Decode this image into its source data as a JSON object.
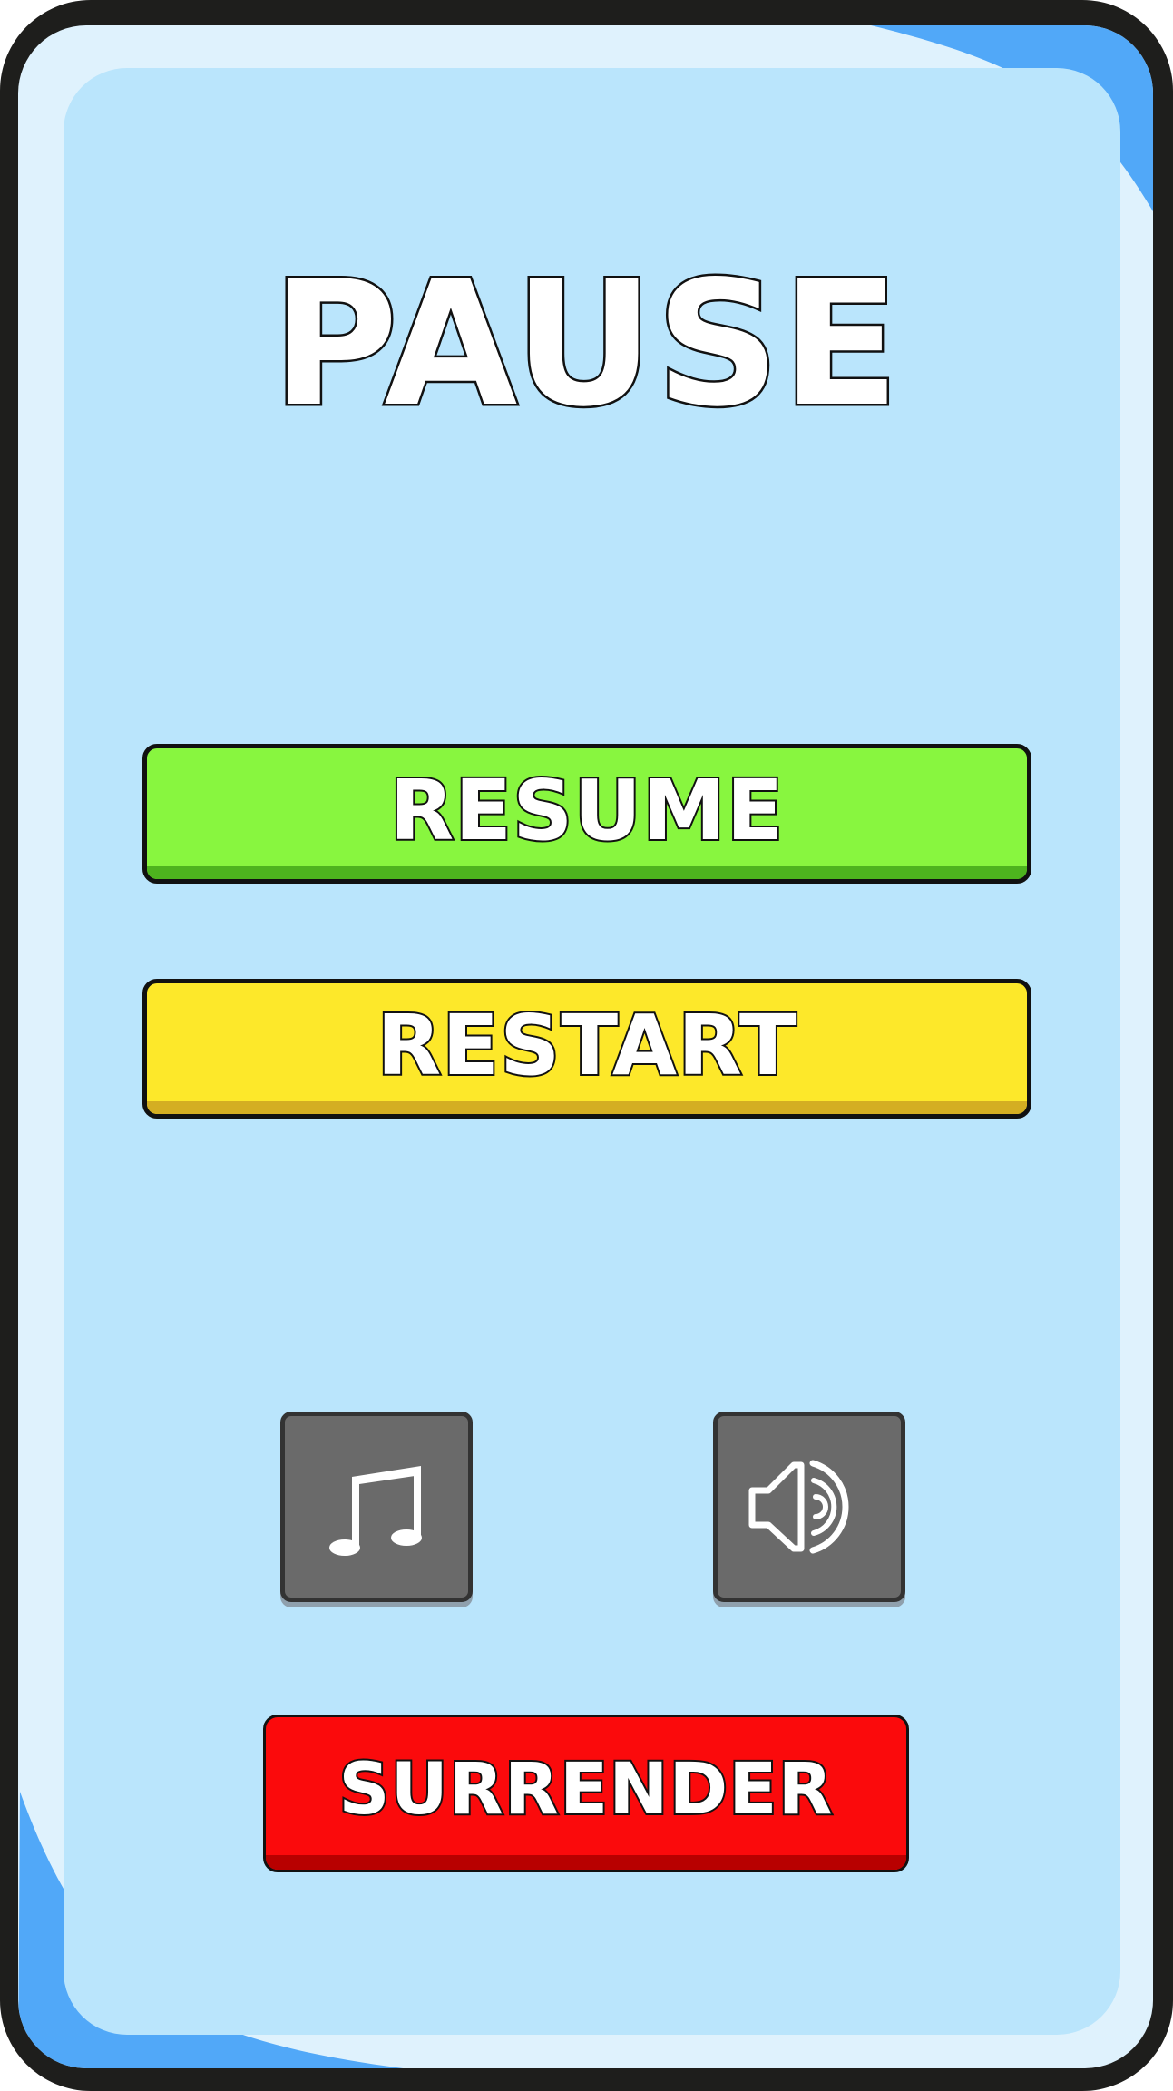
{
  "pause_menu": {
    "title": "PAUSE",
    "buttons": {
      "resume": "RESUME",
      "restart": "RESTART",
      "surrender": "SURRENDER"
    },
    "toggles": [
      {
        "name": "music",
        "icon": "music-note-icon"
      },
      {
        "name": "sound",
        "icon": "speaker-volume-icon"
      }
    ]
  },
  "colors": {
    "frame": "#1e1e1c",
    "panel_outer": "#dff2fd",
    "panel_inner": "#bae5fc",
    "corner_accent": "#51a8f8",
    "resume": "#88f63f",
    "restart": "#fde82a",
    "surrender": "#fb0a0c",
    "toggle": "#6a6a6a"
  }
}
